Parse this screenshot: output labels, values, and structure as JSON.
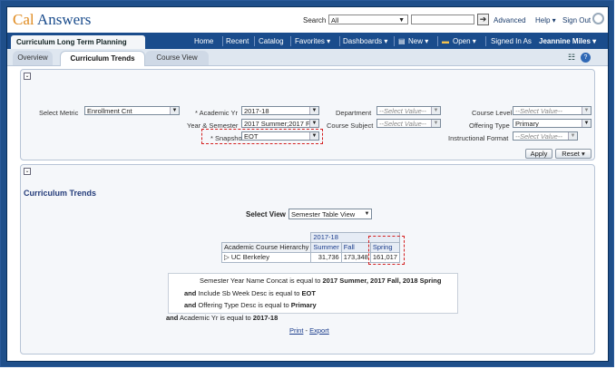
{
  "app": {
    "title_part1": "Cal",
    "title_part2": " Answers"
  },
  "search": {
    "label": "Search",
    "scope": "All",
    "go": "➔"
  },
  "top_links": {
    "advanced": "Advanced",
    "help": "Help ▾",
    "signout": "Sign Out"
  },
  "header": {
    "dashboard_title": "Curriculum Long Term Planning",
    "nav": [
      "Home",
      "Recent",
      "Catalog",
      "Favorites ▾",
      "Dashboards ▾",
      "New ▾",
      "Open ▾"
    ],
    "signed_in_label": "Signed In As",
    "user": "Jeannine Miles ▾"
  },
  "tabs": [
    "Overview",
    "Curriculum Trends",
    "Course View"
  ],
  "prompts": {
    "select_metric": {
      "label": "Select Metric",
      "value": "Enrollment Cnt"
    },
    "academic_yr": {
      "label": "* Academic Yr",
      "value": "2017-18"
    },
    "year_semester": {
      "label": "Year & Semester",
      "value": "2017 Summer;2017 F"
    },
    "snapshot": {
      "label": "* Snapshot",
      "value": "EOT"
    },
    "department": {
      "label": "Department",
      "value": "--Select Value--"
    },
    "course_subject": {
      "label": "Course Subject",
      "value": "--Select Value--"
    },
    "course_level": {
      "label": "Course Level",
      "value": "--Select Value--"
    },
    "offering_type": {
      "label": "Offering Type",
      "value": "Primary"
    },
    "instructional_format": {
      "label": "Instructional Format",
      "value": "--Select Value--"
    },
    "apply": "Apply",
    "reset": "Reset ▾"
  },
  "section": {
    "title": "Curriculum Trends",
    "select_view_label": "Select View",
    "select_view_value": "Semester Table View"
  },
  "pivot": {
    "year": "2017-18",
    "row_header": "Academic Course Hierarchy",
    "columns": [
      "Summer",
      "Fall",
      "Spring"
    ],
    "rows": [
      {
        "label": "▷ UC Berkeley",
        "values": [
          "31,736",
          "173,348",
          "161,017"
        ]
      }
    ]
  },
  "filters": {
    "line1_prefix": "Semester Year Name Concat is equal to ",
    "line1_value": "2017 Summer, 2017 Fall, 2018 Spring",
    "and": "and",
    "line2_prefix": " Include Sb Week Desc is equal to ",
    "line2_value": "EOT",
    "line3_prefix": " Offering Type Desc is equal to ",
    "line3_value": "Primary",
    "line4_prefix": " Academic Yr is equal to ",
    "line4_value": "2017-18"
  },
  "footer_links": {
    "print": "Print",
    "sep": " - ",
    "export": "Export"
  },
  "icons": {
    "search_go": "arrow-right-icon",
    "help": "help-icon",
    "tools": "options-icon"
  }
}
